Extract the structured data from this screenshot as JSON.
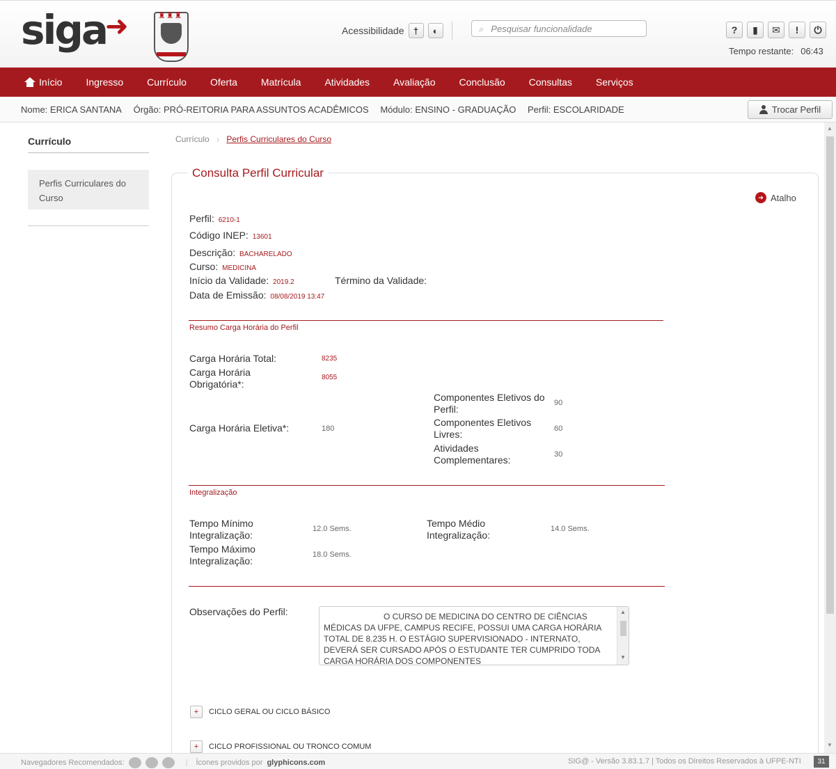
{
  "header": {
    "logo_text": "siga",
    "accessibility_label": "Acessibilidade",
    "search_placeholder": "Pesquisar funcionalidade",
    "time_label": "Tempo restante:",
    "time_value": "06:43"
  },
  "menu": {
    "items": [
      "Início",
      "Ingresso",
      "Currículo",
      "Oferta",
      "Matrícula",
      "Atividades",
      "Avaliação",
      "Conclusão",
      "Consultas",
      "Serviços"
    ]
  },
  "infobar": {
    "nome": "Nome: ERICA SANTANA",
    "orgao": "Órgão: PRÓ-REITORIA PARA ASSUNTOS ACADÊMICOS",
    "modulo": "Módulo: ENSINO - GRADUAÇÃO",
    "perfil": "Perfil: ESCOLARIDADE",
    "trocar_label": "Trocar Perfil"
  },
  "sidebar": {
    "title": "Currículo",
    "item": "Perfis Curriculares do Curso"
  },
  "breadcrumb": {
    "root": "Currículo",
    "current": "Perfis Curriculares do Curso"
  },
  "panel": {
    "title": "Consulta Perfil Curricular",
    "atalho": "Atalho",
    "perfil_label": "Perfil:",
    "perfil_value": "6210-1",
    "inep_label": "Código INEP:",
    "inep_value": "13601",
    "descricao_label": "Descrição:",
    "descricao_value": "BACHARELADO",
    "curso_label": "Curso:",
    "curso_value": "MEDICINA",
    "inicio_label": "Início da Validade:",
    "inicio_value": "2019.2",
    "termino_label": "Término da Validade:",
    "emissao_label": "Data de Emissão:",
    "emissao_value": "08/08/2019 13:47"
  },
  "resumo": {
    "title": "Resumo Carga Horária do Perfil",
    "total_label": "Carga Horária Total:",
    "total_value": "8235",
    "obrig_label": "Carga Horária Obrigatória*:",
    "obrig_value": "8055",
    "eletiva_label": "Carga Horária Eletiva*:",
    "eletiva_value": "180",
    "comp_perfil_label": "Componentes Eletivos do Perfil:",
    "comp_perfil_value": "90",
    "comp_livres_label": "Componentes Eletivos Livres:",
    "comp_livres_value": "60",
    "ativ_label": "Atividades Complementares:",
    "ativ_value": "30"
  },
  "integralizacao": {
    "title": "Integralização",
    "min_label": "Tempo Mínimo Integralização:",
    "min_value": "12.0 Sems.",
    "medio_label": "Tempo Médio Integralização:",
    "medio_value": "14.0 Sems.",
    "max_label": "Tempo Máximo Integralização:",
    "max_value": "18.0 Sems."
  },
  "observacoes": {
    "label": "Observações do Perfil:",
    "text": "O CURSO DE MEDICINA DO CENTRO DE CIÊNCIAS MÉDICAS DA UFPE, CAMPUS RECIFE, POSSUI UMA CARGA HORÁRIA TOTAL DE 8.235 H. O ESTÁGIO SUPERVISIONADO - INTERNATO, DEVERÁ SER CURSADO APÓS O ESTUDANTE TER CUMPRIDO TODA CARGA HORÁRIA DOS COMPONENTES"
  },
  "cycles": [
    "CICLO GERAL OU CICLO BÁSICO",
    "CICLO PROFISSIONAL OU TRONCO COMUM"
  ],
  "footer": {
    "navegadores": "Navegadores Recomendados:",
    "icones_prefix": "Ícones providos por",
    "icones_brand": "glyphicons.com",
    "versao": "SIG@ - Versão 3.83.1.7 | Todos os Direitos Reservados à UFPE-NTI",
    "calendar_day": "31"
  },
  "colors": {
    "brand_red": "#a51a1e"
  },
  "icons": [
    "home-icon",
    "font-size-icon",
    "contrast-icon",
    "search-icon",
    "help-icon",
    "book-icon",
    "mail-icon",
    "info-icon",
    "power-icon",
    "user-icon",
    "shortcut-icon",
    "plus-icon",
    "calendar-icon"
  ]
}
